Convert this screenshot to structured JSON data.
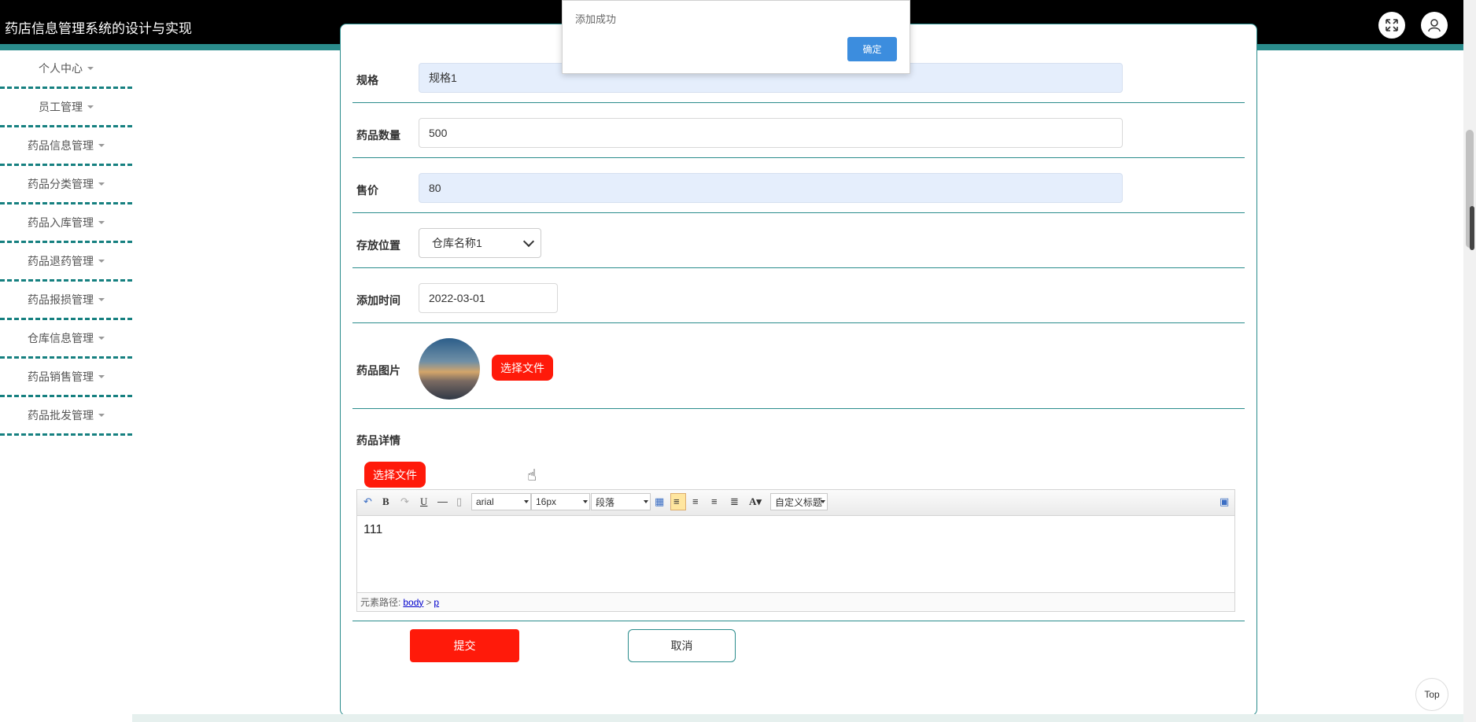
{
  "header": {
    "app_title": "药店信息管理系统的设计与实现"
  },
  "sidebar": {
    "items": [
      {
        "label": "个人中心"
      },
      {
        "label": "员工管理"
      },
      {
        "label": "药品信息管理"
      },
      {
        "label": "药品分类管理"
      },
      {
        "label": "药品入库管理"
      },
      {
        "label": "药品退药管理"
      },
      {
        "label": "药品报损管理"
      },
      {
        "label": "仓库信息管理"
      },
      {
        "label": "药品销售管理"
      },
      {
        "label": "药品批发管理"
      }
    ]
  },
  "form": {
    "spec": {
      "label": "规格",
      "value": "规格1"
    },
    "quantity": {
      "label": "药品数量",
      "value": "500"
    },
    "price": {
      "label": "售价",
      "value": "80"
    },
    "location": {
      "label": "存放位置",
      "value": "仓库名称1"
    },
    "add_time": {
      "label": "添加时间",
      "value": "2022-03-01"
    },
    "image": {
      "label": "药品图片",
      "upload_label": "选择文件"
    },
    "detail": {
      "label": "药品详情",
      "upload_label": "选择文件"
    }
  },
  "editor": {
    "font_family": "arial",
    "font_size": "16px",
    "paragraph": "段落",
    "custom_title": "自定义标题",
    "content": "111",
    "path_label": "元素路径:",
    "path_body": "body",
    "path_sep": ">",
    "path_p": "p"
  },
  "actions": {
    "submit_label": "提交",
    "cancel_label": "取消"
  },
  "dialog": {
    "message": "添加成功",
    "ok_label": "确定"
  },
  "scroll_top": {
    "label": "Top"
  }
}
